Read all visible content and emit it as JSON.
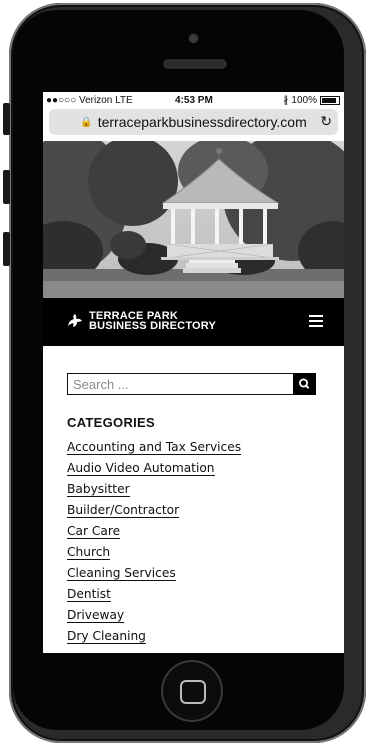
{
  "status_bar": {
    "carrier": "●●○○○ Verizon  LTE",
    "time": "4:53 PM",
    "bluetooth": "bluetooth-icon",
    "battery": "100%"
  },
  "browser": {
    "url": "terraceparkbusinessdirectory.com",
    "lock_icon": "lock-icon",
    "reload_icon": "reload-icon"
  },
  "site": {
    "logo_line1": "TERRACE PARK",
    "logo_line2": "BUSINESS DIRECTORY",
    "menu_icon": "hamburger-menu-icon"
  },
  "search": {
    "placeholder": "Search ...",
    "value": "",
    "button_icon": "search-icon"
  },
  "categories": {
    "heading": "CATEGORIES",
    "items": [
      "Accounting and Tax Services",
      "Audio Video Automation",
      "Babysitter",
      "Builder/Contractor",
      "Car Care",
      "Church",
      "Cleaning Services",
      "Dentist",
      "Driveway",
      "Dry Cleaning"
    ]
  }
}
